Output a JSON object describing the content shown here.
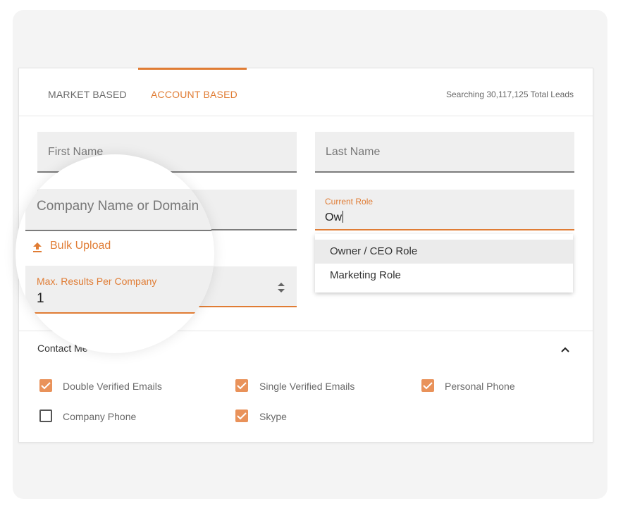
{
  "tabs": [
    {
      "label": "MARKET BASED",
      "active": false
    },
    {
      "label": "ACCOUNT BASED",
      "active": true
    }
  ],
  "searching_text": "Searching 30,117,125 Total Leads",
  "fields": {
    "first_name_placeholder": "First Name",
    "last_name_placeholder": "Last Name",
    "company_placeholder": "Company Name or Domain",
    "current_role_label": "Current Role",
    "current_role_value": "Ow",
    "max_results_label": "Max. Results Per Company",
    "max_results_value": "1"
  },
  "role_dropdown": [
    "Owner / CEO Role",
    "Marketing Role"
  ],
  "bulk_upload_label": "Bulk Upload",
  "contact_methods": {
    "title": "Contact Me",
    "options": [
      {
        "label": "Double Verified Emails",
        "checked": true
      },
      {
        "label": "Single Verified Emails",
        "checked": true
      },
      {
        "label": "Personal Phone",
        "checked": true
      },
      {
        "label": "Company Phone",
        "checked": false
      },
      {
        "label": "Skype",
        "checked": true
      }
    ]
  },
  "colors": {
    "accent": "#e07c34",
    "checkbox": "#e9925a"
  },
  "icons": {
    "upload": "upload-icon",
    "collapse": "chevron-up-icon",
    "stepper": "stepper-icon",
    "check": "check-icon"
  }
}
